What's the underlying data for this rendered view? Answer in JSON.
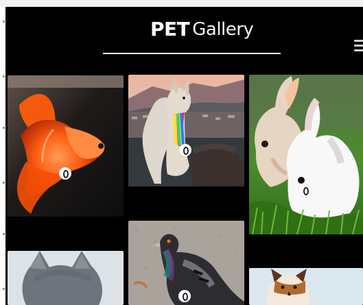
{
  "header": {
    "title_bold": "PET",
    "title_light": "Gallery"
  },
  "icons": {
    "menu": "menu-icon",
    "view": "eye-icon"
  },
  "gallery": {
    "items": [
      {
        "animal": "fish"
      },
      {
        "animal": "llama"
      },
      {
        "animal": "rabbit"
      },
      {
        "animal": "cat"
      },
      {
        "animal": "pigeon"
      },
      {
        "animal": "dog"
      }
    ]
  },
  "colors": {
    "background": "#000000",
    "text": "#ffffff",
    "accent": "#ffffff"
  }
}
